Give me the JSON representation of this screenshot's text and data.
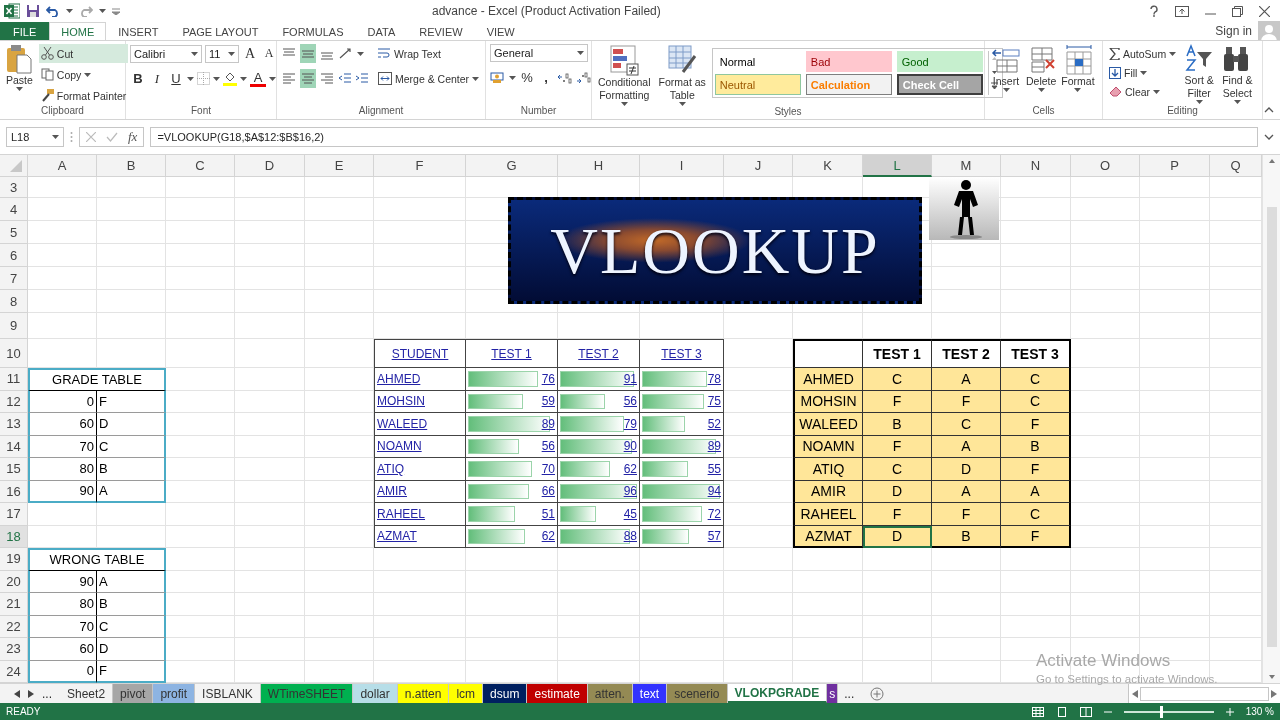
{
  "window": {
    "title": "advance - Excel (Product Activation Failed)",
    "sign_in": "Sign in"
  },
  "ribbon_tabs": [
    {
      "label": "FILE",
      "kind": "file",
      "selected": false
    },
    {
      "label": "HOME",
      "kind": "tab",
      "selected": true
    },
    {
      "label": "INSERT",
      "kind": "tab",
      "selected": false
    },
    {
      "label": "PAGE LAYOUT",
      "kind": "tab",
      "selected": false
    },
    {
      "label": "FORMULAS",
      "kind": "tab",
      "selected": false
    },
    {
      "label": "DATA",
      "kind": "tab",
      "selected": false
    },
    {
      "label": "REVIEW",
      "kind": "tab",
      "selected": false
    },
    {
      "label": "VIEW",
      "kind": "tab",
      "selected": false
    }
  ],
  "ribbon": {
    "clipboard": {
      "label": "Clipboard",
      "paste": "Paste",
      "cut": "Cut",
      "copy": "Copy",
      "format_painter": "Format Painter"
    },
    "font": {
      "label": "Font",
      "name": "Calibri",
      "size": "11",
      "grow": "A",
      "shrink": "A",
      "bold": "B",
      "italic": "I",
      "underline": "U",
      "font_color": "A"
    },
    "alignment": {
      "label": "Alignment",
      "vertical": [
        {
          "kind": "top",
          "selected": false
        },
        {
          "kind": "middle",
          "selected": true
        },
        {
          "kind": "bottom",
          "selected": false
        }
      ],
      "horizontal": [
        {
          "kind": "left",
          "selected": false
        },
        {
          "kind": "center",
          "selected": true
        },
        {
          "kind": "right",
          "selected": false
        }
      ],
      "wrap_text": "Wrap Text",
      "merge_center": "Merge & Center"
    },
    "number": {
      "label": "Number",
      "format": "General",
      "percent": "%",
      "comma": ","
    },
    "styles": {
      "label": "Styles",
      "conditional_formatting": [
        "Conditional",
        "Formatting"
      ],
      "format_as_table": [
        "Format as",
        "Table"
      ],
      "cell_styles": [
        {
          "label": "Normal",
          "kind": "normal"
        },
        {
          "label": "Bad",
          "kind": "bad"
        },
        {
          "label": "Good",
          "kind": "good"
        },
        {
          "label": "Neutral",
          "kind": "neutral"
        },
        {
          "label": "Calculation",
          "kind": "calculation"
        },
        {
          "label": "Check Cell",
          "kind": "check"
        }
      ]
    },
    "cells": {
      "label": "Cells",
      "buttons": [
        {
          "label": "Insert",
          "kind": "insert"
        },
        {
          "label": "Delete",
          "kind": "delete"
        },
        {
          "label": "Format",
          "kind": "format"
        }
      ]
    },
    "editing": {
      "label": "Editing",
      "autosum": "AutoSum",
      "fill": "Fill",
      "clear": "Clear",
      "sort_filter": [
        "Sort &",
        "Filter"
      ],
      "find_select": [
        "Find &",
        "Select"
      ]
    }
  },
  "formula_bar": {
    "name_box": "L18",
    "fx": "fx",
    "formula": "=VLOOKUP(G18,$A$12:$B$16,2)"
  },
  "columns": [
    {
      "label": "A",
      "selected": false
    },
    {
      "label": "B",
      "selected": false
    },
    {
      "label": "C",
      "selected": false
    },
    {
      "label": "D",
      "selected": false
    },
    {
      "label": "E",
      "selected": false
    },
    {
      "label": "F",
      "selected": false
    },
    {
      "label": "G",
      "selected": false
    },
    {
      "label": "H",
      "selected": false
    },
    {
      "label": "I",
      "selected": false
    },
    {
      "label": "J",
      "selected": false
    },
    {
      "label": "K",
      "selected": false
    },
    {
      "label": "L",
      "selected": true
    },
    {
      "label": "M",
      "selected": false
    },
    {
      "label": "N",
      "selected": false
    },
    {
      "label": "O",
      "selected": false
    },
    {
      "label": "P",
      "selected": false
    },
    {
      "label": "Q",
      "selected": false
    }
  ],
  "rows": [
    {
      "label": "3",
      "selected": false
    },
    {
      "label": "4",
      "selected": false
    },
    {
      "label": "5",
      "selected": false
    },
    {
      "label": "6",
      "selected": false
    },
    {
      "label": "7",
      "selected": false
    },
    {
      "label": "8",
      "selected": false
    },
    {
      "label": "9",
      "selected": false
    },
    {
      "label": "10",
      "selected": false
    },
    {
      "label": "11",
      "selected": false
    },
    {
      "label": "12",
      "selected": false
    },
    {
      "label": "13",
      "selected": false
    },
    {
      "label": "14",
      "selected": false
    },
    {
      "label": "15",
      "selected": false
    },
    {
      "label": "16",
      "selected": false
    },
    {
      "label": "17",
      "selected": false
    },
    {
      "label": "18",
      "selected": true
    },
    {
      "label": "19",
      "selected": false
    },
    {
      "label": "20",
      "selected": false
    },
    {
      "label": "21",
      "selected": false
    },
    {
      "label": "22",
      "selected": false
    },
    {
      "label": "23",
      "selected": false
    },
    {
      "label": "24",
      "selected": false
    }
  ],
  "banner": {
    "title": "VLOOKUP"
  },
  "grade_table": {
    "title": "GRADE TABLE",
    "rows": [
      {
        "score": "0",
        "grade": "F"
      },
      {
        "score": "60",
        "grade": "D"
      },
      {
        "score": "70",
        "grade": "C"
      },
      {
        "score": "80",
        "grade": "B"
      },
      {
        "score": "90",
        "grade": "A"
      }
    ]
  },
  "wrong_table": {
    "title": "WRONG TABLE",
    "rows": [
      {
        "score": "90",
        "grade": "A"
      },
      {
        "score": "80",
        "grade": "B"
      },
      {
        "score": "70",
        "grade": "C"
      },
      {
        "score": "60",
        "grade": "D"
      },
      {
        "score": "0",
        "grade": "F"
      }
    ]
  },
  "scores_table": {
    "columns": [
      "STUDENT",
      "TEST 1",
      "TEST 2",
      "TEST 3"
    ],
    "rows": [
      {
        "student": "AHMED",
        "scores": [
          {
            "value": "76",
            "level": 0.8
          },
          {
            "value": "91",
            "level": 0.96
          },
          {
            "value": "78",
            "level": 0.82
          }
        ]
      },
      {
        "student": "MOHSIN",
        "scores": [
          {
            "value": "59",
            "level": 0.63
          },
          {
            "value": "56",
            "level": 0.58
          },
          {
            "value": "75",
            "level": 0.78
          }
        ]
      },
      {
        "student": "WALEED",
        "scores": [
          {
            "value": "89",
            "level": 0.94
          },
          {
            "value": "79",
            "level": 0.83
          },
          {
            "value": "52",
            "level": 0.54
          }
        ]
      },
      {
        "student": "NOAMN",
        "scores": [
          {
            "value": "56",
            "level": 0.59
          },
          {
            "value": "90",
            "level": 0.94
          },
          {
            "value": "89",
            "level": 0.94
          }
        ]
      },
      {
        "student": "ATIQ",
        "scores": [
          {
            "value": "70",
            "level": 0.74
          },
          {
            "value": "62",
            "level": 0.65
          },
          {
            "value": "55",
            "level": 0.58
          }
        ]
      },
      {
        "student": "AMIR",
        "scores": [
          {
            "value": "66",
            "level": 0.7
          },
          {
            "value": "96",
            "level": 1
          },
          {
            "value": "94",
            "level": 0.99
          }
        ]
      },
      {
        "student": "RAHEEL",
        "scores": [
          {
            "value": "51",
            "level": 0.54
          },
          {
            "value": "45",
            "level": 0.47
          },
          {
            "value": "72",
            "level": 0.76
          }
        ]
      },
      {
        "student": "AZMAT",
        "scores": [
          {
            "value": "62",
            "level": 0.66
          },
          {
            "value": "88",
            "level": 0.91
          },
          {
            "value": "57",
            "level": 0.6
          }
        ]
      }
    ]
  },
  "grades_table": {
    "columns": [
      "TEST 1",
      "TEST 2",
      "TEST 3"
    ],
    "rows": [
      {
        "student": "AHMED",
        "grades": [
          {
            "value": "C",
            "selected": false
          },
          {
            "value": "A",
            "selected": false
          },
          {
            "value": "C",
            "selected": false
          }
        ]
      },
      {
        "student": "MOHSIN",
        "grades": [
          {
            "value": "F",
            "selected": false
          },
          {
            "value": "F",
            "selected": false
          },
          {
            "value": "C",
            "selected": false
          }
        ]
      },
      {
        "student": "WALEED",
        "grades": [
          {
            "value": "B",
            "selected": false
          },
          {
            "value": "C",
            "selected": false
          },
          {
            "value": "F",
            "selected": false
          }
        ]
      },
      {
        "student": "NOAMN",
        "grades": [
          {
            "value": "F",
            "selected": false
          },
          {
            "value": "A",
            "selected": false
          },
          {
            "value": "B",
            "selected": false
          }
        ]
      },
      {
        "student": "ATIQ",
        "grades": [
          {
            "value": "C",
            "selected": false
          },
          {
            "value": "D",
            "selected": false
          },
          {
            "value": "F",
            "selected": false
          }
        ]
      },
      {
        "student": "AMIR",
        "grades": [
          {
            "value": "D",
            "selected": false
          },
          {
            "value": "A",
            "selected": false
          },
          {
            "value": "A",
            "selected": false
          }
        ]
      },
      {
        "student": "RAHEEL",
        "grades": [
          {
            "value": "F",
            "selected": false
          },
          {
            "value": "F",
            "selected": false
          },
          {
            "value": "C",
            "selected": false
          }
        ]
      },
      {
        "student": "AZMAT",
        "grades": [
          {
            "value": "D",
            "selected": true
          },
          {
            "value": "B",
            "selected": false
          },
          {
            "value": "F",
            "selected": false
          }
        ]
      }
    ]
  },
  "sheet_tabs": {
    "leading_ellipsis": "...",
    "trailing_ellipsis": "...",
    "tabs": [
      {
        "label": "Sheet2",
        "selected": false
      },
      {
        "label": "pivot",
        "color": "#a6a6a6",
        "selected": false
      },
      {
        "label": "profit",
        "color": "#8db4e2",
        "selected": false
      },
      {
        "label": "ISBLANK",
        "selected": false
      },
      {
        "label": "WTimeSHEET",
        "color": "#00b050",
        "selected": false
      },
      {
        "label": "dollar",
        "color": "#b7dee8",
        "selected": false
      },
      {
        "label": "n.atten",
        "color": "#ffff00",
        "selected": false
      },
      {
        "label": "lcm",
        "color": "#ffff00",
        "selected": false
      },
      {
        "label": "dsum",
        "color": "#002060",
        "selected": false
      },
      {
        "label": "estimate",
        "color": "#c00000",
        "selected": false
      },
      {
        "label": "atten.",
        "color": "#948a54",
        "selected": false
      },
      {
        "label": "text",
        "color": "#3333ff",
        "selected": false
      },
      {
        "label": "scenerio",
        "color": "#948a54",
        "selected": false
      },
      {
        "label": "VLOKPGRADE",
        "selected": true
      },
      {
        "label": "s",
        "color": "#7030a0",
        "selected": false
      }
    ]
  },
  "status_bar": {
    "status": "READY",
    "zoom": "130 %",
    "zoom_slider": {
      "level": 0.4
    }
  },
  "activation_notice": {
    "title": "Activate Windows",
    "message": "Go to Settings to activate Windows."
  }
}
